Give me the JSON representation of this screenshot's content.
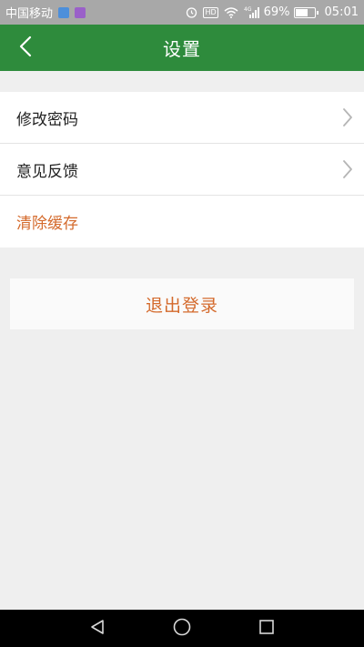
{
  "status_bar": {
    "carrier": "中国移动",
    "battery_percent": "69%",
    "battery_level": 0.69,
    "time": "05:01",
    "hd_label": "HD",
    "network_label": "4G",
    "icons": [
      "app-notification-icon",
      "gallery-notification-icon",
      "alarm-icon",
      "hd-icon",
      "wifi-icon",
      "signal-icon",
      "battery-icon"
    ]
  },
  "header": {
    "title": "设置",
    "back_icon": "chevron-left-icon",
    "background_color": "#2e8b3c"
  },
  "settings": {
    "items": [
      {
        "label": "修改密码",
        "has_chevron": true
      },
      {
        "label": "意见反馈",
        "has_chevron": true
      },
      {
        "label": "清除缓存",
        "has_chevron": false
      }
    ]
  },
  "logout": {
    "label": "退出登录"
  },
  "accent_color": "#d46a2c",
  "nav_bar": {
    "icons": [
      "back-triangle-icon",
      "home-circle-icon",
      "recents-square-icon"
    ]
  }
}
